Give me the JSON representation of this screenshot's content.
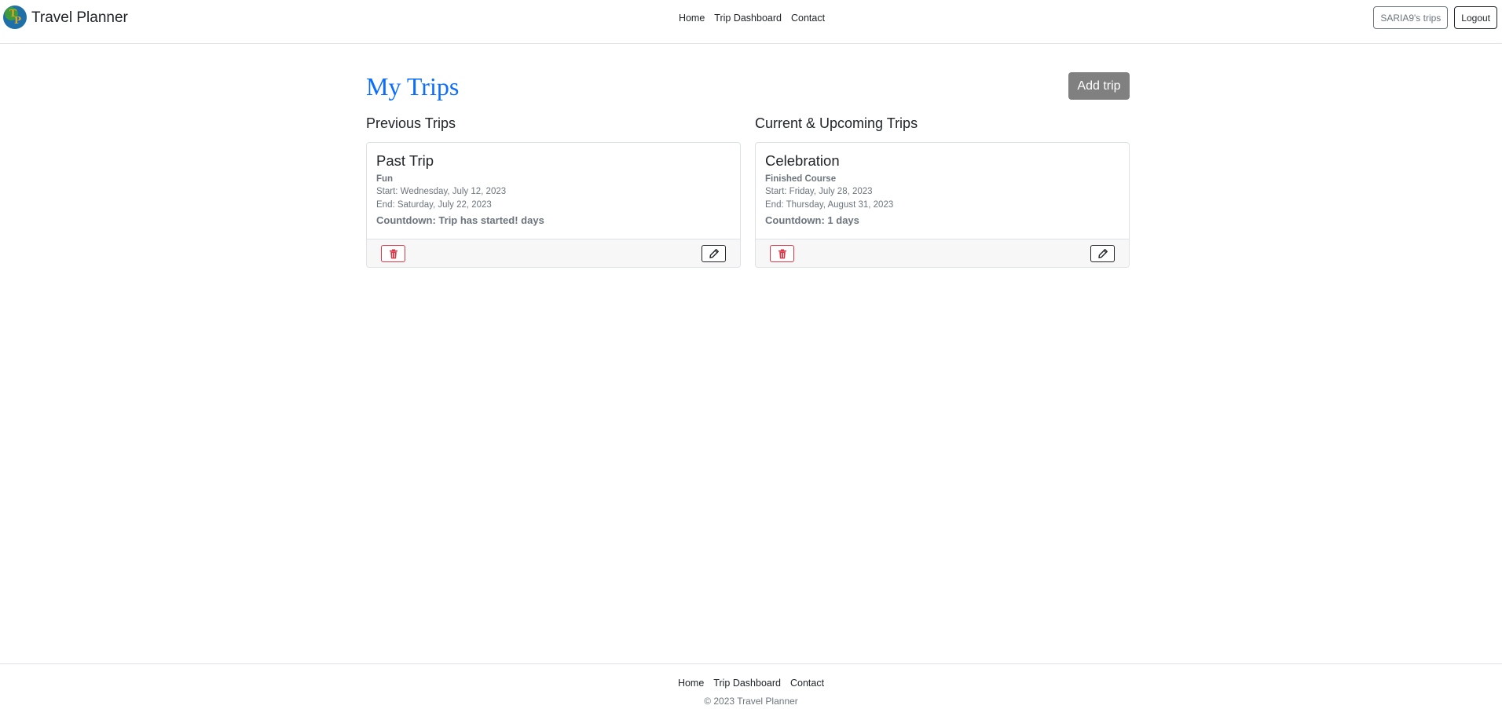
{
  "brand": {
    "name": "Travel Planner",
    "logo_letters": [
      "T",
      "P"
    ]
  },
  "nav": {
    "links": [
      "Home",
      "Trip Dashboard",
      "Contact"
    ],
    "user_button": "SARIA9's trips",
    "logout_button": "Logout"
  },
  "main": {
    "title": "My Trips",
    "add_button": "Add trip",
    "previous_heading": "Previous Trips",
    "upcoming_heading": "Current & Upcoming Trips"
  },
  "previous_trips": [
    {
      "name": "Past Trip",
      "description": "Fun",
      "start": "Start: Wednesday, July 12, 2023",
      "end": "End: Saturday, July 22, 2023",
      "countdown": "Countdown: Trip has started! days"
    }
  ],
  "upcoming_trips": [
    {
      "name": "Celebration",
      "description": "Finished Course",
      "start": "Start: Friday, July 28, 2023",
      "end": "End: Thursday, August 31, 2023",
      "countdown": "Countdown: 1 days"
    }
  ],
  "footer": {
    "links": [
      "Home",
      "Trip Dashboard",
      "Contact"
    ],
    "copyright": "© 2023 Travel Planner"
  },
  "colors": {
    "title": "#0d6efd",
    "add_button_bg": "#808080",
    "delete_accent": "#dc3545",
    "muted_text": "#6c757d"
  },
  "icons": {
    "delete": "trash-icon",
    "edit": "pencil-icon"
  }
}
